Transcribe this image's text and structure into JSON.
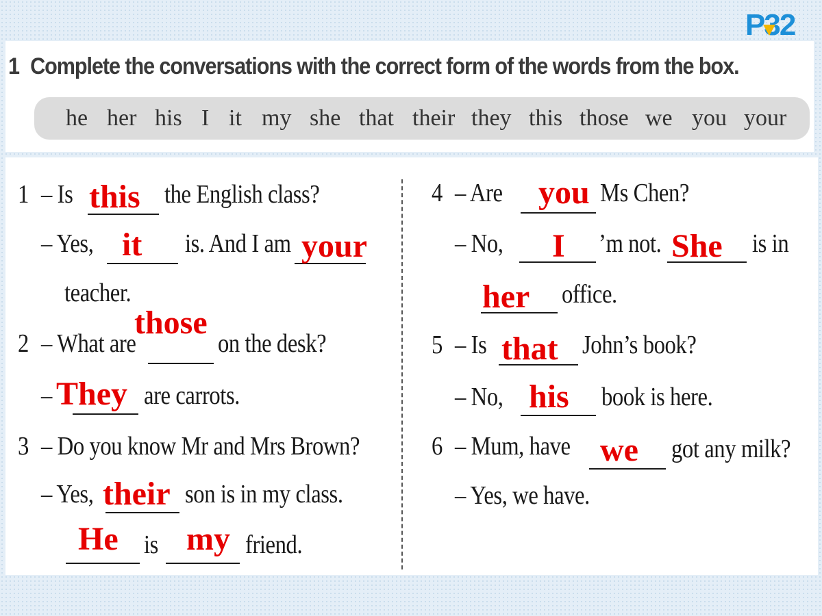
{
  "page_label": "P32",
  "instruction": {
    "number": "1",
    "text": "Complete the conversations with the correct form of the words from the box."
  },
  "word_box": [
    "he",
    "her",
    "his",
    "I",
    "it",
    "my",
    "she",
    "that",
    "their",
    "they",
    "this",
    "those",
    "we",
    "you",
    "your"
  ],
  "conversations": {
    "c1": {
      "number": "1",
      "line1a": "– Is",
      "line1b": "the English class?",
      "line2a": "– Yes,",
      "line2b": "is. And I am",
      "line3": "teacher."
    },
    "c2": {
      "number": "2",
      "line1a": "– What are",
      "line1b": "on the desk?",
      "line2a": "–",
      "line2b": "are carrots."
    },
    "c3": {
      "number": "3",
      "line1": "– Do you know Mr and Mrs Brown?",
      "line2a": "– Yes,",
      "line2b": "son is in my class.",
      "line3a": "is",
      "line3b": "friend."
    },
    "c4": {
      "number": "4",
      "line1a": "– Are",
      "line1b": "Ms Chen?",
      "line2a": "– No,",
      "line2b": "’m not.",
      "line2c": "is in",
      "line3": "office."
    },
    "c5": {
      "number": "5",
      "line1a": "– Is",
      "line1b": "John’s book?",
      "line2a": "– No,",
      "line2b": "book is here."
    },
    "c6": {
      "number": "6",
      "line1a": "– Mum, have",
      "line1b": "got any milk?",
      "line2": "– Yes, we have."
    }
  },
  "answers": {
    "a1": "this",
    "a2": "it",
    "a3": "your",
    "a4": "those",
    "a5": "They",
    "a6": "their",
    "a7": "He",
    "a8": "my",
    "a9": "you",
    "a10": "I",
    "a11": "She",
    "a12": "her",
    "a13": "that",
    "a14": "his",
    "a15": "we"
  },
  "colors": {
    "answer": "#e60000",
    "page_label": "#1d8fd8",
    "arrow": "#f2b600"
  }
}
